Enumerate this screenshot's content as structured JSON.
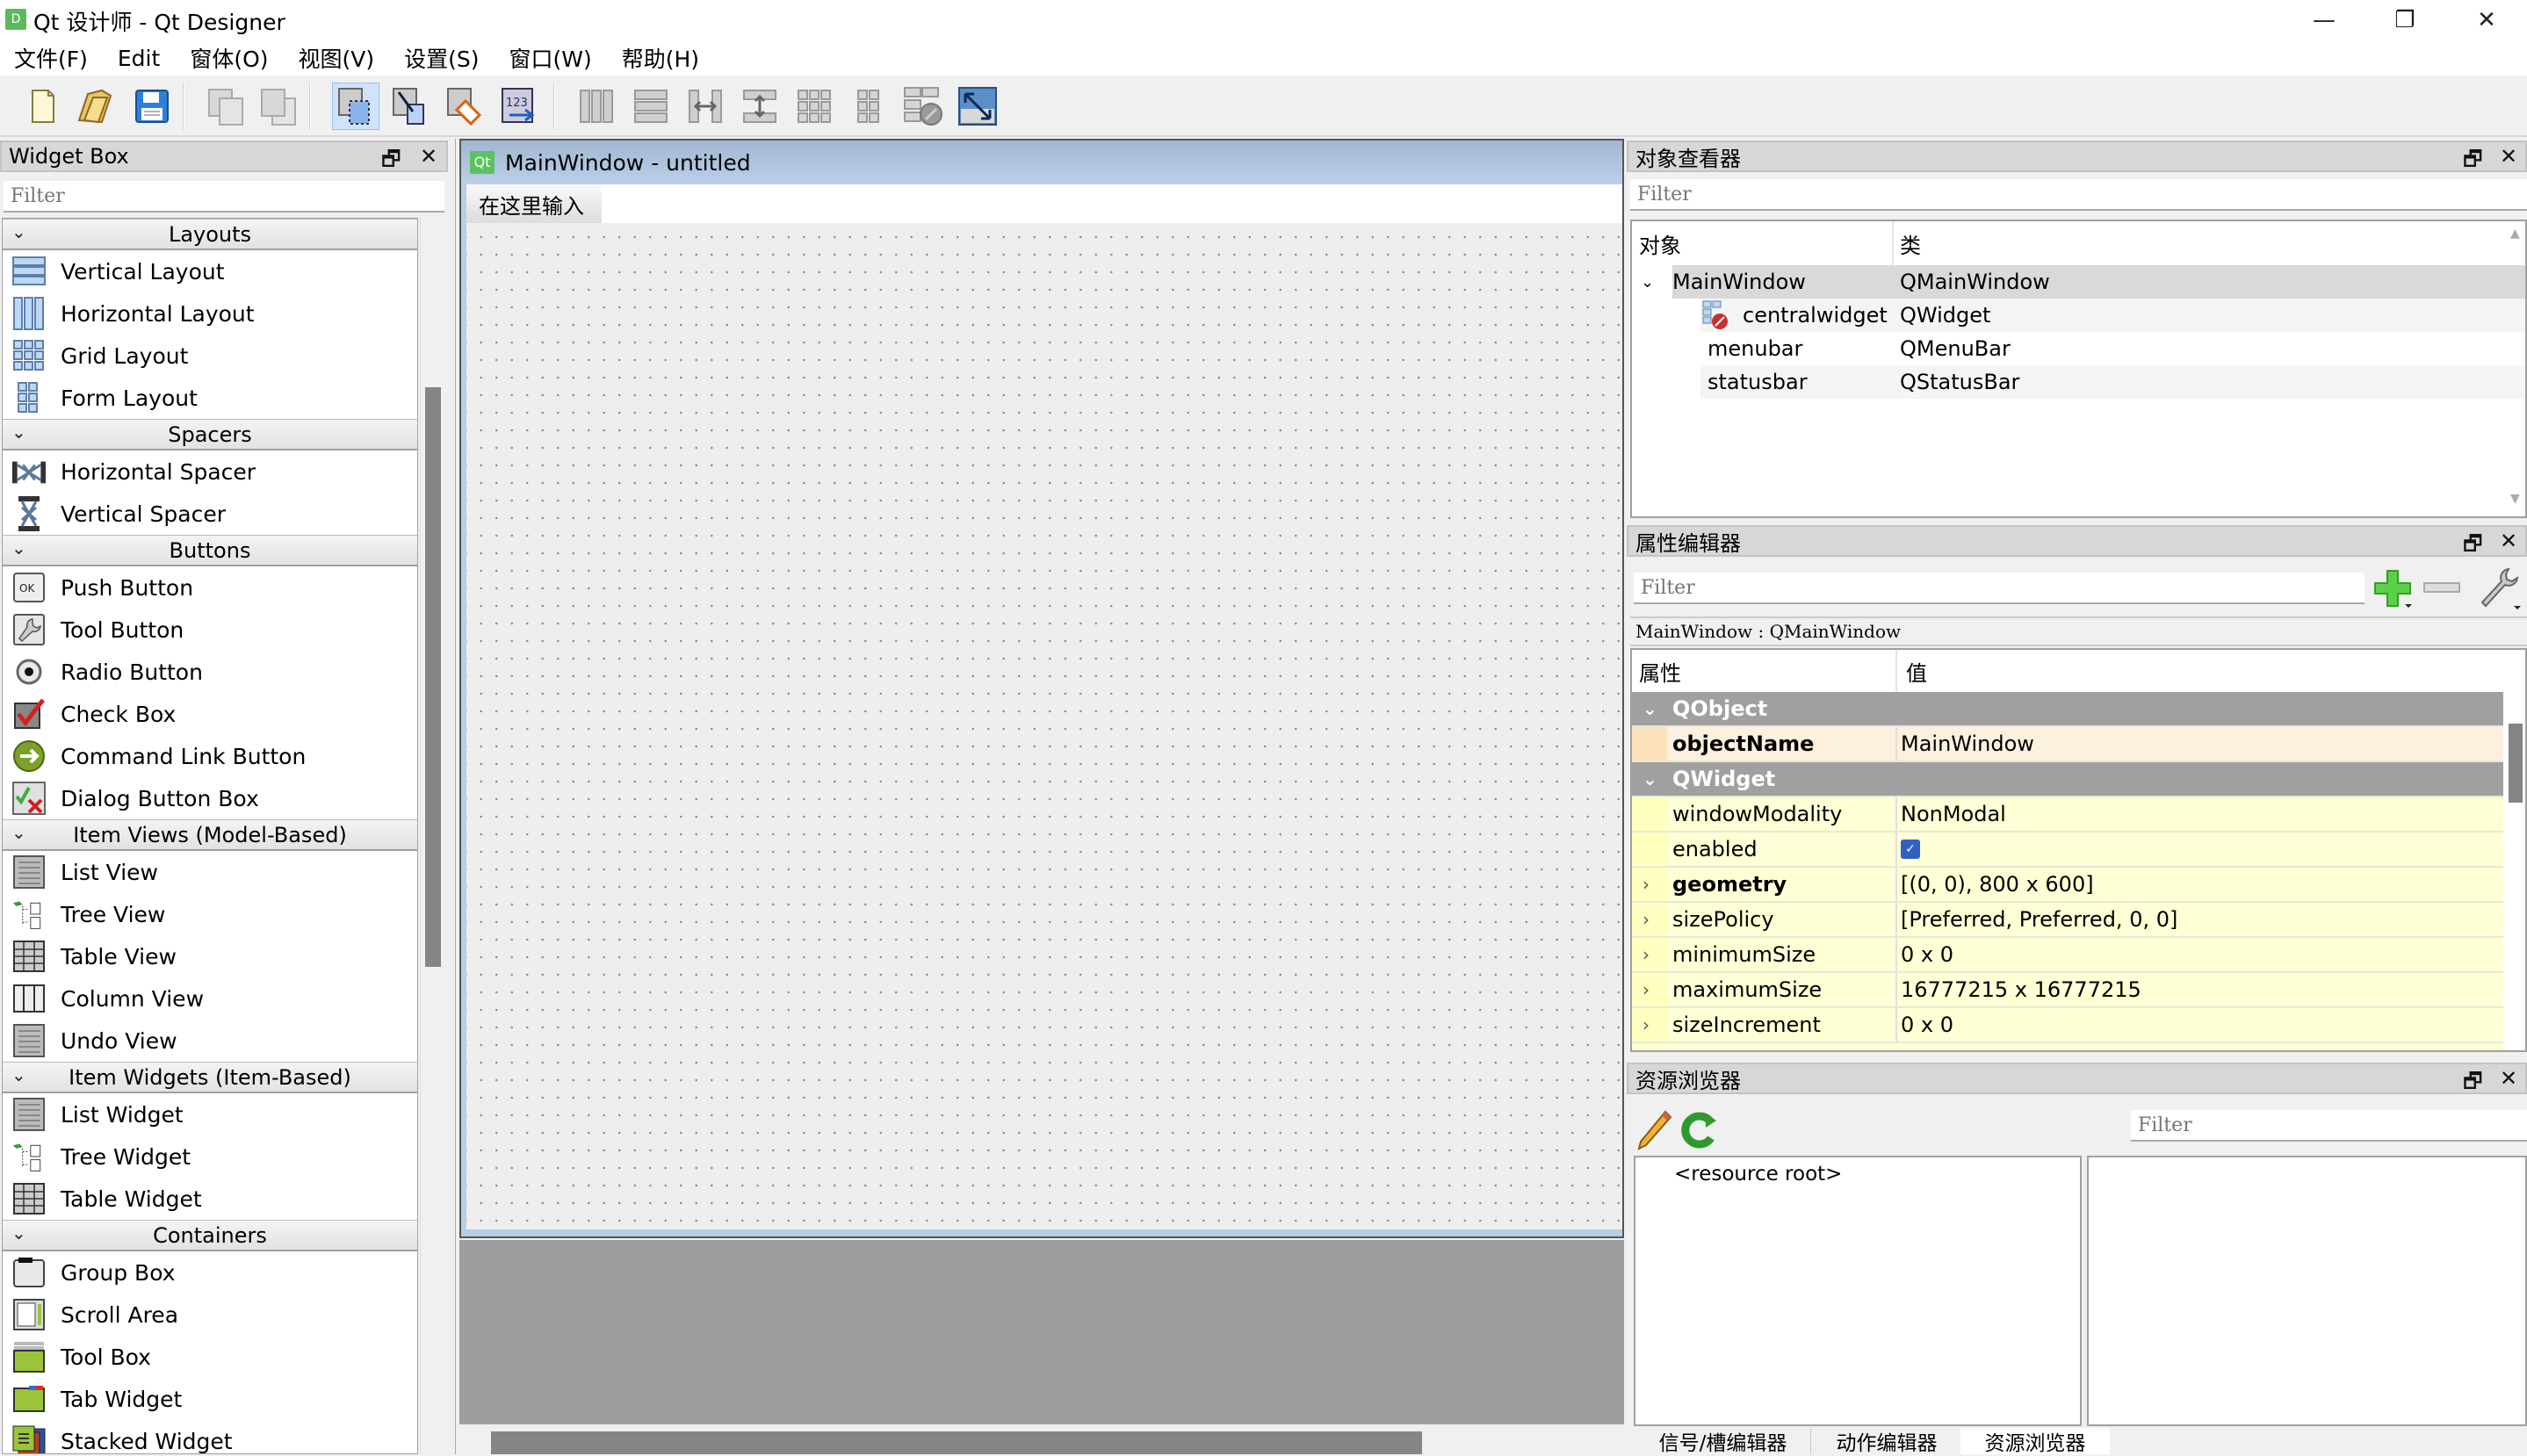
{
  "window": {
    "title": "Qt 设计师 - Qt Designer",
    "app_icon_letter": "D",
    "controls": {
      "minimize": "—",
      "maximize": "❐",
      "close": "✕"
    }
  },
  "menubar": {
    "items": [
      "文件(F)",
      "Edit",
      "窗体(O)",
      "视图(V)",
      "设置(S)",
      "窗口(W)",
      "帮助(H)"
    ]
  },
  "toolbar": {
    "groups": [
      [
        "new-form",
        "open-form",
        "save-form"
      ],
      [
        "bring-to-front",
        "send-to-back"
      ],
      [
        "edit-widgets",
        "edit-signals-slots",
        "edit-buddies",
        "edit-tab-order"
      ],
      [
        "lay-out-horizontally",
        "lay-out-vertically",
        "lay-out-horizontally-in-splitter",
        "lay-out-vertically-in-splitter",
        "lay-out-in-grid",
        "lay-out-in-form",
        "break-layout",
        "adjust-size"
      ]
    ],
    "active": "edit-widgets"
  },
  "widget_box": {
    "title": "Widget Box",
    "filter_placeholder": "Filter",
    "categories": [
      {
        "name": "Layouts",
        "items": [
          {
            "label": "Vertical Layout",
            "icon": "vertical-layout"
          },
          {
            "label": "Horizontal Layout",
            "icon": "horizontal-layout"
          },
          {
            "label": "Grid Layout",
            "icon": "grid-layout"
          },
          {
            "label": "Form Layout",
            "icon": "form-layout"
          }
        ]
      },
      {
        "name": "Spacers",
        "items": [
          {
            "label": "Horizontal Spacer",
            "icon": "horizontal-spacer"
          },
          {
            "label": "Vertical Spacer",
            "icon": "vertical-spacer"
          }
        ]
      },
      {
        "name": "Buttons",
        "items": [
          {
            "label": "Push Button",
            "icon": "push-button"
          },
          {
            "label": "Tool Button",
            "icon": "tool-button"
          },
          {
            "label": "Radio Button",
            "icon": "radio-button"
          },
          {
            "label": "Check Box",
            "icon": "check-box"
          },
          {
            "label": "Command Link Button",
            "icon": "command-link"
          },
          {
            "label": "Dialog Button Box",
            "icon": "dialog-button-box"
          }
        ]
      },
      {
        "name": "Item Views (Model-Based)",
        "items": [
          {
            "label": "List View",
            "icon": "list-view"
          },
          {
            "label": "Tree View",
            "icon": "tree-view"
          },
          {
            "label": "Table View",
            "icon": "table-view"
          },
          {
            "label": "Column View",
            "icon": "column-view"
          },
          {
            "label": "Undo View",
            "icon": "undo-view"
          }
        ]
      },
      {
        "name": "Item Widgets (Item-Based)",
        "items": [
          {
            "label": "List Widget",
            "icon": "list-widget"
          },
          {
            "label": "Tree Widget",
            "icon": "tree-widget"
          },
          {
            "label": "Table Widget",
            "icon": "table-widget"
          }
        ]
      },
      {
        "name": "Containers",
        "items": [
          {
            "label": "Group Box",
            "icon": "group-box"
          },
          {
            "label": "Scroll Area",
            "icon": "scroll-area"
          },
          {
            "label": "Tool Box",
            "icon": "tool-box"
          },
          {
            "label": "Tab Widget",
            "icon": "tab-widget"
          },
          {
            "label": "Stacked Widget",
            "icon": "stacked-widget"
          }
        ]
      }
    ]
  },
  "form": {
    "badge": "Qt",
    "title": "MainWindow - untitled",
    "menu_placeholder": "在这里输入"
  },
  "object_inspector": {
    "title": "对象查看器",
    "filter_placeholder": "Filter",
    "columns": [
      "对象",
      "类"
    ],
    "rows": [
      {
        "object": "MainWindow",
        "class": "QMainWindow",
        "level": 0,
        "expanded": true,
        "selected": true
      },
      {
        "object": "centralwidget",
        "class": "QWidget",
        "level": 1,
        "icon": "broken-layout"
      },
      {
        "object": "menubar",
        "class": "QMenuBar",
        "level": 1
      },
      {
        "object": "statusbar",
        "class": "QStatusBar",
        "level": 1
      }
    ]
  },
  "property_editor": {
    "title": "属性编辑器",
    "filter_placeholder": "Filter",
    "context": "MainWindow : QMainWindow",
    "columns": [
      "属性",
      "值"
    ],
    "rows": [
      {
        "type": "group",
        "name": "QObject"
      },
      {
        "type": "prop",
        "name": "objectName",
        "value": "MainWindow",
        "bold": true,
        "tone": "orange"
      },
      {
        "type": "group",
        "name": "QWidget"
      },
      {
        "type": "prop",
        "name": "windowModality",
        "value": "NonModal",
        "tone": "yellow"
      },
      {
        "type": "prop",
        "name": "enabled",
        "value": true,
        "checkbox": true,
        "tone": "yellow"
      },
      {
        "type": "prop",
        "name": "geometry",
        "value": "[(0, 0), 800 x 600]",
        "bold": true,
        "expandable": true,
        "tone": "yellow"
      },
      {
        "type": "prop",
        "name": "sizePolicy",
        "value": "[Preferred, Preferred, 0, 0]",
        "expandable": true,
        "tone": "yellow"
      },
      {
        "type": "prop",
        "name": "minimumSize",
        "value": "0 x 0",
        "expandable": true,
        "tone": "yellow"
      },
      {
        "type": "prop",
        "name": "maximumSize",
        "value": "16777215 x 16777215",
        "expandable": true,
        "tone": "yellow"
      },
      {
        "type": "prop",
        "name": "sizeIncrement",
        "value": "0 x 0",
        "expandable": true,
        "tone": "yellow"
      }
    ]
  },
  "resource_browser": {
    "title": "资源浏览器",
    "filter_placeholder": "Filter",
    "root_label": "<resource root>"
  },
  "bottom_tabs": [
    "信号/槽编辑器",
    "动作编辑器",
    "资源浏览器"
  ],
  "bottom_tab_active": 2,
  "dock_controls": {
    "float": "🗗",
    "close": "✕"
  }
}
